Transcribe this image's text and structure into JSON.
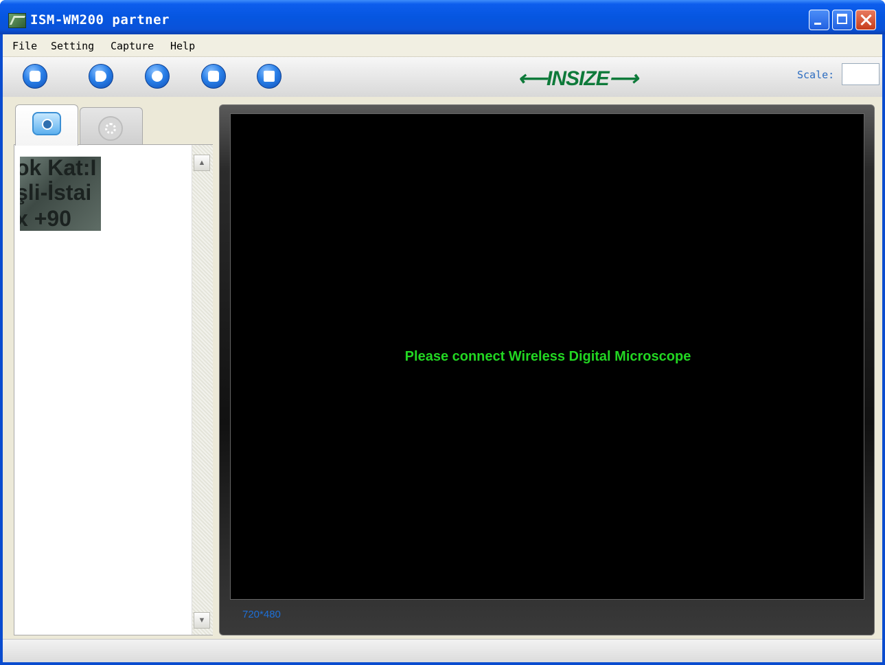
{
  "window": {
    "title": "ISM-WM200 partner",
    "buttons": [
      "minimize",
      "maximize",
      "close"
    ]
  },
  "menu": {
    "items": [
      "File",
      "Setting",
      "Capture",
      "Help"
    ]
  },
  "toolbar": {
    "buttons": [
      {
        "icon": "camera-icon"
      },
      {
        "icon": "video-camera-icon"
      },
      {
        "icon": "timer-icon"
      },
      {
        "icon": "import-icon"
      },
      {
        "icon": "save-icon"
      }
    ],
    "logo": "⟵INSIZE⟶",
    "scale_label": "Scale:",
    "scale_value": ""
  },
  "side_panel": {
    "tabs": [
      {
        "icon": "photo-tab-icon",
        "active": true
      },
      {
        "icon": "video-tab-icon",
        "active": false
      }
    ],
    "thumbnails": [
      {
        "lines": [
          "ok Kat:I",
          "şli-İstai",
          "x +90"
        ]
      }
    ]
  },
  "viewer": {
    "message": "Please connect Wireless Digital Microscope",
    "resolution": "720*480"
  },
  "colors": {
    "title_bar": "#0656e0",
    "message": "#22d622",
    "resolution": "#1e6fd6",
    "logo": "#0e7a3a"
  }
}
